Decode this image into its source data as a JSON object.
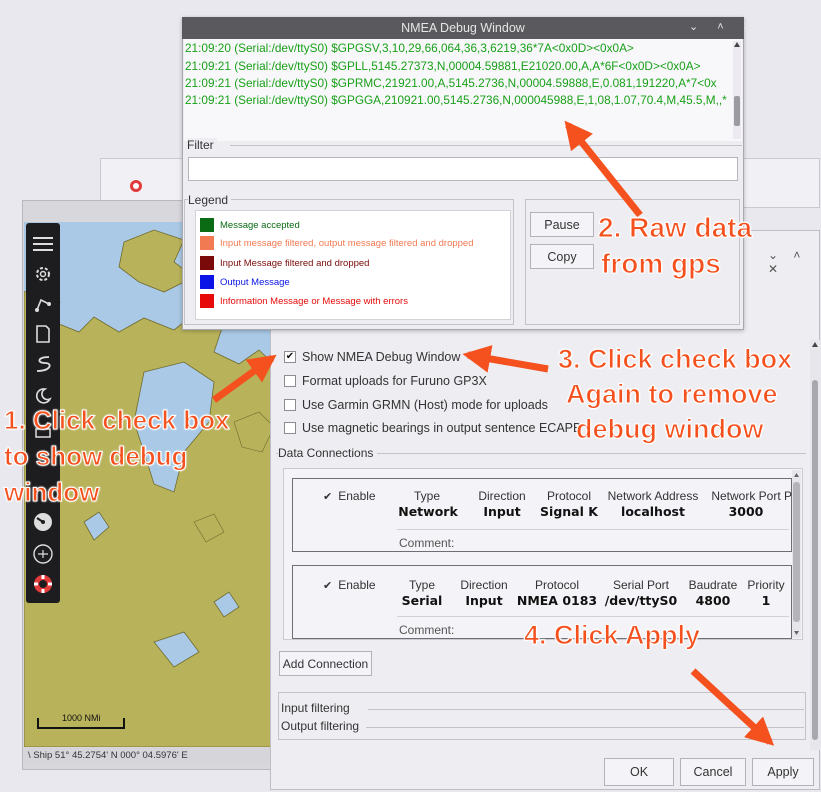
{
  "nmea_window": {
    "title": "NMEA Debug Window",
    "controls": "⌄ ˄ ✕",
    "log_lines": [
      "21:09:20 (Serial:/dev/ttyS0) $GPGSV,3,10,29,66,064,36,3,6219,36*7A<0x0D><0x0A>",
      "21:09:21 (Serial:/dev/ttyS0) $GPLL,5145.27373,N,00004.59881,E21020.00,A,A*6F<0x0D><0x0A>",
      "21:09:21 (Serial:/dev/ttyS0) $GPRMC,21921.00,A,5145.2736,N,00004.59888,E,0.081,191220,A*7<0x",
      "21:09:21 (Serial:/dev/ttyS0) $GPGGA,210921.00,5145.2736,N,000045988,E,1,08,1.07,70.4,M,45.5,M,,*"
    ],
    "filter_label": "Filter",
    "filter_value": "",
    "legend_label": "Legend",
    "legend": [
      {
        "text": "Message accepted",
        "color": "#0a6b14",
        "text_color": "#0a6b14"
      },
      {
        "text": "Input message filtered, output message filtered and dropped",
        "color": "#f27a52",
        "text_color": "#f27a52"
      },
      {
        "text": "Input Message filtered and dropped",
        "color": "#7a0a0a",
        "text_color": "#7a0a0a"
      },
      {
        "text": "Output Message",
        "color": "#0a14e6",
        "text_color": "#0a14e6"
      },
      {
        "text": "Information Message or Message with errors",
        "color": "#e60a0a",
        "text_color": "#e60a0a"
      }
    ],
    "pause_label": "Pause",
    "copy_label": "Copy"
  },
  "options": {
    "titlebar_controls": "⌄ ˄ ✕",
    "checkboxes": [
      {
        "label": "Show NMEA Debug Window",
        "checked": true
      },
      {
        "label": "Format uploads for Furuno GP3X",
        "checked": false
      },
      {
        "label": "Use Garmin GRMN (Host) mode for uploads",
        "checked": false
      },
      {
        "label": "Use magnetic bearings in output sentence ECAPB",
        "checked": false
      }
    ],
    "data_connections_label": "Data Connections",
    "connections": [
      {
        "enable_label": "Enable",
        "enabled": true,
        "headers": [
          "Type",
          "Direction",
          "Protocol",
          "Network Address",
          "Network Port",
          "P"
        ],
        "values": [
          "Network",
          "Input",
          "Signal K",
          "localhost",
          "3000",
          ""
        ],
        "comment_label": "Comment:"
      },
      {
        "enable_label": "Enable",
        "enabled": true,
        "headers": [
          "Type",
          "Direction",
          "Protocol",
          "Serial Port",
          "Baudrate",
          "Priority"
        ],
        "values": [
          "Serial",
          "Input",
          "NMEA 0183",
          "/dev/ttyS0",
          "4800",
          "1"
        ],
        "comment_label": "Comment:"
      }
    ],
    "add_connection_label": "Add Connection",
    "input_filtering_label": "Input filtering",
    "output_filtering_label": "Output filtering",
    "ok_label": "OK",
    "cancel_label": "Cancel",
    "apply_label": "Apply"
  },
  "chart": {
    "scale_label": "1000 NMi",
    "status_text": "\\ Ship 51° 45.2754' N   000° 04.5976' E"
  },
  "annotations": {
    "step1_lines": [
      "1. Click check box",
      "to show debug",
      "window"
    ],
    "step2_lines": [
      "2. Raw data",
      "from gps"
    ],
    "step3_lines": [
      "3. Click check box",
      "Again to remove",
      "debug window"
    ],
    "step4": "4. Click Apply",
    "color": "#f4511e"
  }
}
